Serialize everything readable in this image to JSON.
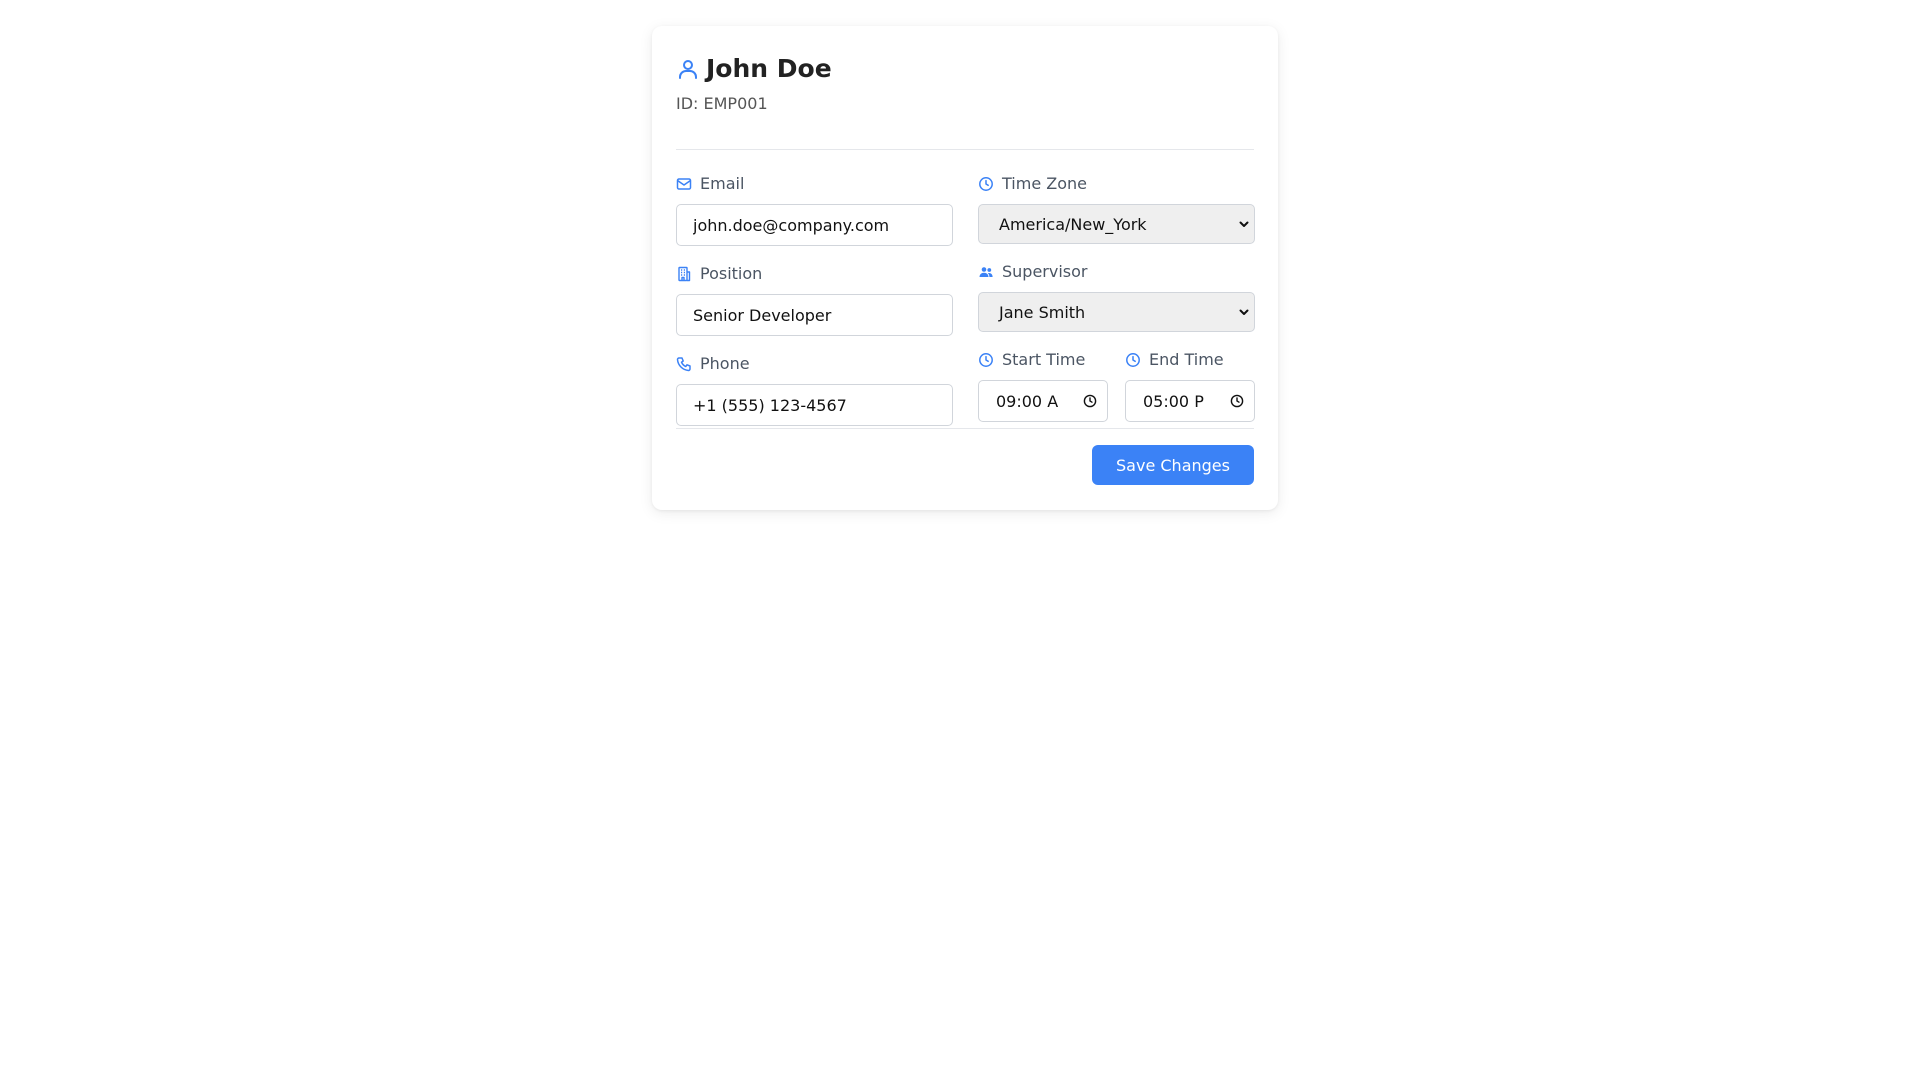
{
  "profile": {
    "name": "John Doe",
    "id_text": "ID: EMP001"
  },
  "fields": {
    "email": {
      "label": "Email",
      "value": "john.doe@company.com"
    },
    "position": {
      "label": "Position",
      "value": "Senior Developer"
    },
    "phone": {
      "label": "Phone",
      "value": "+1 (555) 123-4567"
    },
    "timezone": {
      "label": "Time Zone",
      "value": "America/New_York"
    },
    "supervisor": {
      "label": "Supervisor",
      "value": "Jane Smith"
    },
    "start_time": {
      "label": "Start Time",
      "value": "09:00 A"
    },
    "end_time": {
      "label": "End Time",
      "value": "05:00 P"
    }
  },
  "actions": {
    "save_label": "Save Changes"
  },
  "icons": {
    "profile": "user-icon",
    "email": "mail-icon",
    "position": "building-icon",
    "phone": "phone-icon",
    "timezone": "clock-icon",
    "supervisor": "users-icon",
    "start_time": "clock-icon",
    "end_time": "clock-icon"
  },
  "colors": {
    "accent": "#3b82f6",
    "icon": "#3b82f6",
    "label": "#4b5563",
    "select_bg": "#efefef"
  }
}
